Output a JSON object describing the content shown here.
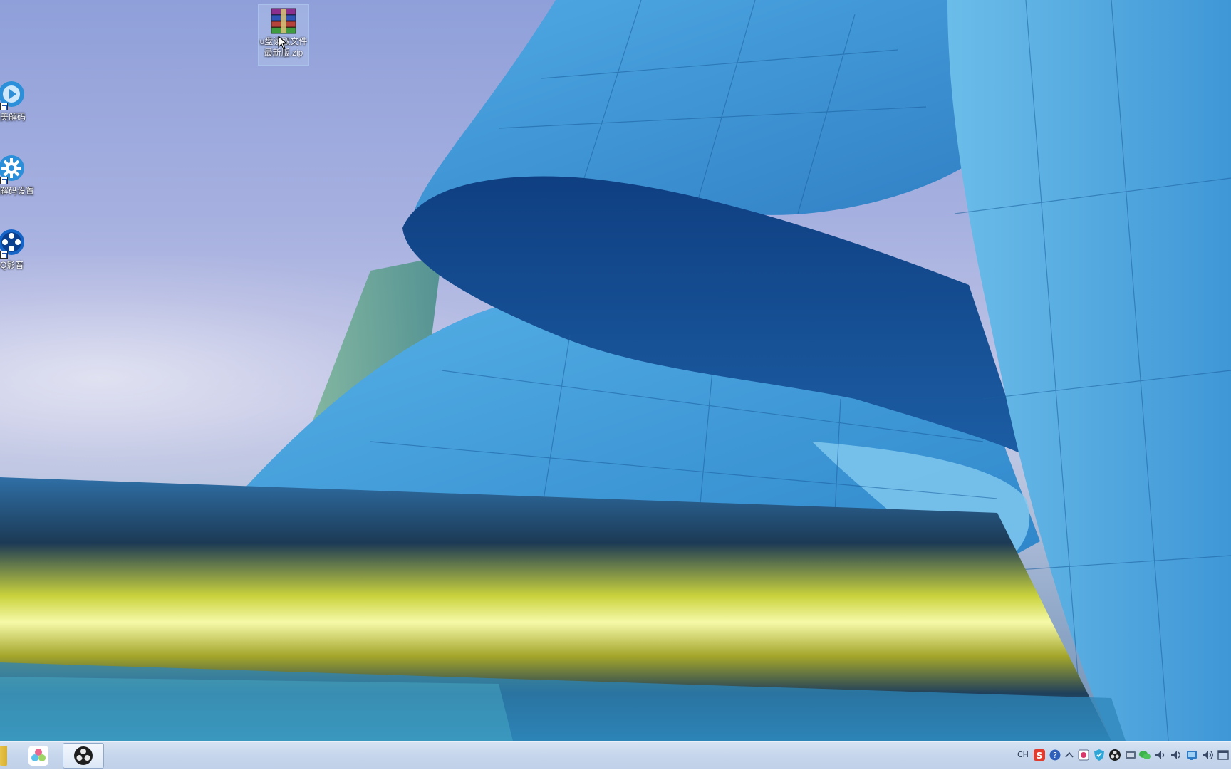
{
  "desktop": {
    "icons": [
      {
        "label": "u盘读取文件\n最新版.zip",
        "icon": "winrar-archive-icon"
      },
      {
        "label": "完美解码",
        "icon": "media-player-icon"
      },
      {
        "label": "完美解码设置",
        "icon": "gear-settings-icon"
      },
      {
        "label": "QQ影音",
        "icon": "qq-player-icon"
      }
    ]
  },
  "taskbar": {
    "language": "CH",
    "apps": [
      {
        "icon": "file-explorer-icon"
      },
      {
        "icon": "pinwheel-app-icon"
      },
      {
        "icon": "obs-studio-icon"
      }
    ],
    "tray_icons": [
      "sogou-input-icon",
      "help-icon",
      "tray-arrow-icon",
      "app-icon",
      "shield-icon",
      "obs-tray-icon",
      "network-icon",
      "wechat-icon",
      "volume-icon",
      "network-status-icon",
      "show-desktop-icon"
    ]
  },
  "colors": {
    "taskbar": "#c6d6ec",
    "sky": "#8f9fd9",
    "building": "#3f8fd0",
    "stripe": "#e4ec6a"
  }
}
